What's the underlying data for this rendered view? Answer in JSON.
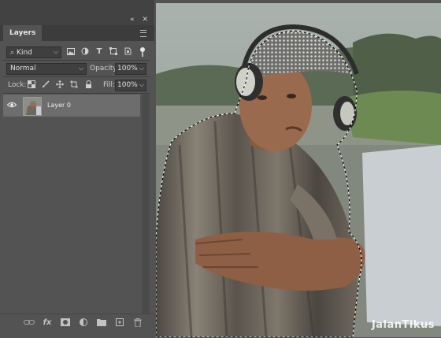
{
  "panel": {
    "collapse_icon": "double-chevron-icon",
    "close_icon": "close-icon",
    "tab_label": "Layers",
    "menu_icon": "menu-icon"
  },
  "filter": {
    "kind_label": "Kind",
    "icons": [
      "image-icon",
      "adjustment-icon",
      "text-icon",
      "shape-icon",
      "smart-object-icon"
    ]
  },
  "blend": {
    "mode": "Normal",
    "opacity_label": "Opacity:",
    "opacity_value": "100%"
  },
  "lock": {
    "label": "Lock:",
    "icons": [
      "transparency-lock-icon",
      "brush-lock-icon",
      "move-lock-icon",
      "artboard-lock-icon",
      "lock-all-icon"
    ],
    "fill_label": "Fill:",
    "fill_value": "100%"
  },
  "layers": [
    {
      "name": "Layer 0",
      "visible": true
    }
  ],
  "bottom_toolbar": [
    "link-icon",
    "fx-icon",
    "mask-icon",
    "adjustment-layer-icon",
    "folder-icon",
    "new-layer-icon",
    "trash-icon"
  ],
  "canvas": {
    "watermark": "JalanTikus"
  },
  "colors": {
    "panel_bg": "#535353",
    "selected_layer": "#6d6d6d",
    "skin": "#9a6a4e",
    "shirt": "#6e6860"
  }
}
